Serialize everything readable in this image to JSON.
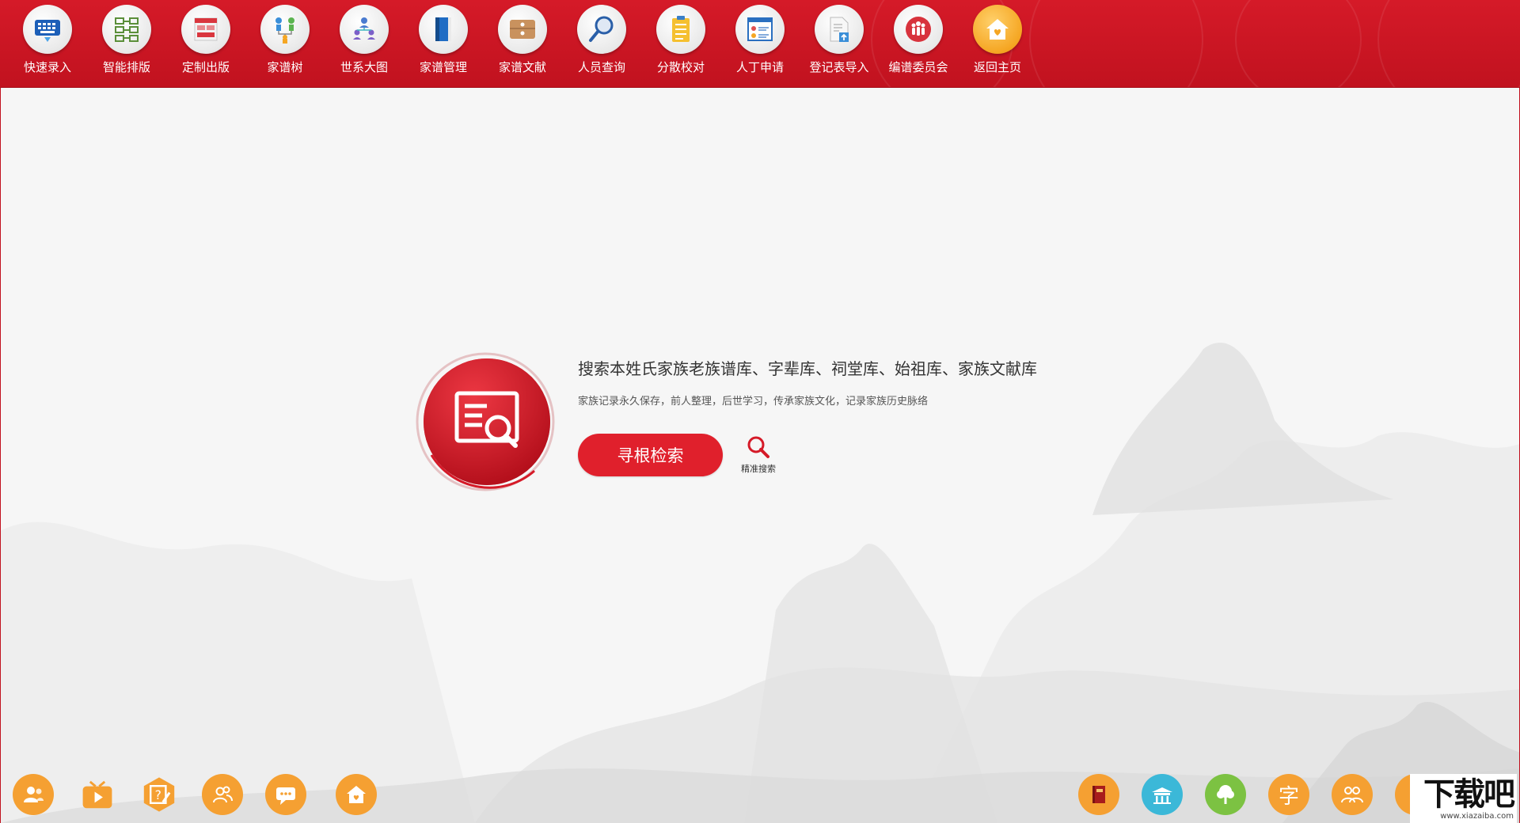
{
  "toolbar": {
    "items": [
      {
        "label": "快速录入",
        "icon": "keyboard-icon"
      },
      {
        "label": "智能排版",
        "icon": "layout-icon"
      },
      {
        "label": "定制出版",
        "icon": "publish-icon"
      },
      {
        "label": "家谱树",
        "icon": "family-tree-icon"
      },
      {
        "label": "世系大图",
        "icon": "lineage-chart-icon"
      },
      {
        "label": "家谱管理",
        "icon": "book-icon"
      },
      {
        "label": "家谱文献",
        "icon": "archive-icon"
      },
      {
        "label": "人员查询",
        "icon": "magnifier-icon"
      },
      {
        "label": "分散校对",
        "icon": "checklist-icon"
      },
      {
        "label": "人丁申请",
        "icon": "application-form-icon"
      },
      {
        "label": "登记表导入",
        "icon": "import-document-icon"
      },
      {
        "label": "编谱委员会",
        "icon": "committee-icon"
      },
      {
        "label": "返回主页",
        "icon": "home-icon"
      }
    ]
  },
  "search": {
    "headline": "搜索本姓氏家族老族谱库、字辈库、祠堂库、始祖库、家族文献库",
    "subline": "家族记录永久保存，前人整理，后世学习，传承家族文化，记录家族历史脉络",
    "button_label": "寻根检索",
    "precise_label": "精准搜索"
  },
  "bottom_left": [
    {
      "icon": "users-icon"
    },
    {
      "icon": "video-play-icon"
    },
    {
      "icon": "question-edit-icon"
    },
    {
      "icon": "group-icon"
    },
    {
      "icon": "message-icon"
    },
    {
      "icon": "home-heart-icon"
    }
  ],
  "bottom_right": [
    {
      "icon": "book-icon"
    },
    {
      "icon": "ancestral-hall-icon"
    },
    {
      "icon": "tree-icon"
    },
    {
      "icon": "character-icon",
      "char": "字"
    },
    {
      "icon": "people-icon"
    }
  ],
  "watermark": {
    "big": "下载吧",
    "small": "www.xiazaiba.com"
  },
  "colors": {
    "brand_red": "#d51a28",
    "button_red": "#e0202c",
    "bottom_orange": "#f5a032",
    "bottom_cyan": "#3bb8d8",
    "bottom_green": "#7cc242"
  }
}
